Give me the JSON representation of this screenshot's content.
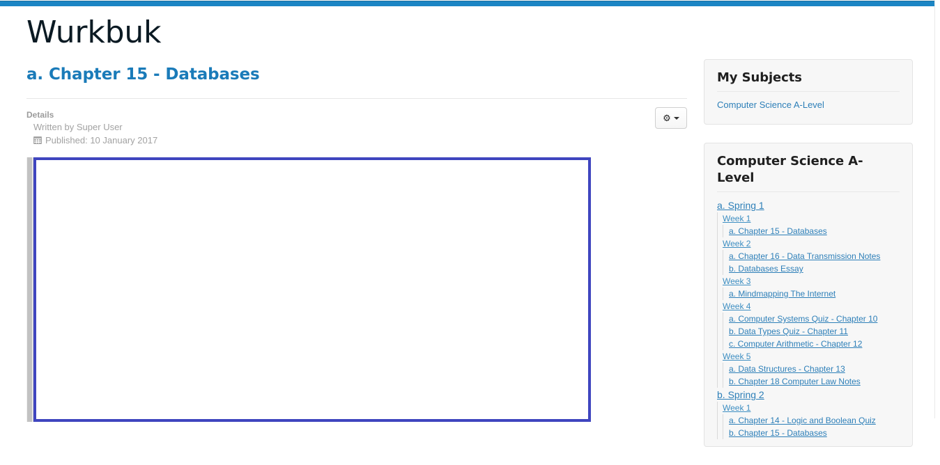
{
  "site": {
    "title": "Wurkbuk",
    "accent_color": "#1b85c4"
  },
  "article": {
    "title": "a. Chapter 15 - Databases",
    "details_heading": "Details",
    "author_line": "Written by Super User",
    "published_line": "Published: 10 January 2017",
    "calendar_icon": "calendar-icon"
  },
  "toolbar": {
    "gear_icon": "gear-icon",
    "gear_glyph": "⚙",
    "caret_icon": "chevron-down-icon"
  },
  "editor": {
    "frame_border_color": "#3f45bf",
    "scrollbar_icon": "vertical-scrollbar"
  },
  "sidebar": {
    "subjects_module": {
      "title": "My Subjects",
      "items": [
        {
          "label": "Computer Science A-Level"
        }
      ]
    },
    "nav_module": {
      "title": "Computer Science A-Level",
      "terms": [
        {
          "label": "a. Spring 1",
          "weeks": [
            {
              "label": "Week 1",
              "items": [
                {
                  "label": "a. Chapter 15 - Databases"
                }
              ]
            },
            {
              "label": "Week 2",
              "items": [
                {
                  "label": "a. Chapter 16 - Data Transmission Notes"
                },
                {
                  "label": "b. Databases Essay"
                }
              ]
            },
            {
              "label": "Week 3",
              "items": [
                {
                  "label": "a. Mindmapping The Internet"
                }
              ]
            },
            {
              "label": "Week 4",
              "items": [
                {
                  "label": "a. Computer Systems Quiz - Chapter 10"
                },
                {
                  "label": "b. Data Types Quiz - Chapter 11"
                },
                {
                  "label": "c. Computer Arithmetic - Chapter 12"
                }
              ]
            },
            {
              "label": "Week 5",
              "items": [
                {
                  "label": "a. Data Structures - Chapter 13"
                },
                {
                  "label": "b. Chapter 18 Computer Law Notes"
                }
              ]
            }
          ]
        },
        {
          "label": "b. Spring 2",
          "weeks": [
            {
              "label": "Week 1",
              "items": [
                {
                  "label": "a. Chapter 14 - Logic and Boolean Quiz"
                },
                {
                  "label": "b. Chapter 15 - Databases"
                }
              ]
            }
          ]
        }
      ]
    }
  }
}
